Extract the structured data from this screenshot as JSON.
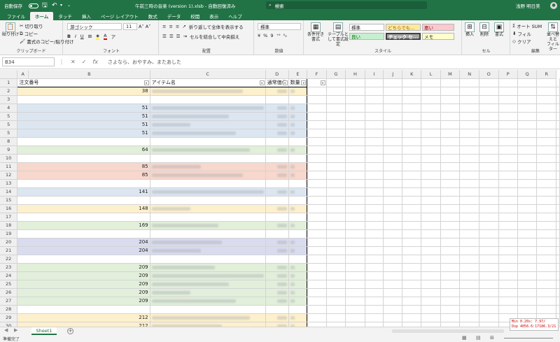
{
  "titlebar": {
    "autosave": "自動保存",
    "title": "午前三時の音楽 (version 1).xlsb - 自動回復済み",
    "search_placeholder": "検索",
    "user": "浅野 明日美"
  },
  "tabs": [
    "ファイル",
    "ホーム",
    "タッチ",
    "挿入",
    "ページ レイアウト",
    "数式",
    "データ",
    "校閲",
    "表示",
    "ヘルプ"
  ],
  "ribbon": {
    "clipboard": {
      "paste": "貼り付け",
      "cut": "切り取り",
      "copy": "コピー",
      "format_painter": "書式のコピー/貼り付け",
      "label": "クリップボード"
    },
    "font": {
      "name": "游ゴシック",
      "size": "11",
      "label": "フォント"
    },
    "alignment": {
      "wrap": "折り返して全体を表示する",
      "merge": "セルを結合して中央揃え",
      "label": "配置"
    },
    "number": {
      "format": "標準",
      "label": "数値"
    },
    "styles": {
      "cond_format": "条件付き書式",
      "table_format": "テーブルとして書式設定",
      "standard": "標準",
      "neutral": "どちらでも...",
      "bad": "悪い",
      "good": "良い",
      "check": "チェック セ...",
      "memo": "メモ",
      "label": "スタイル"
    },
    "cells": {
      "insert": "挿入",
      "delete": "削除",
      "format": "書式",
      "label": "セル"
    },
    "editing": {
      "autosum": "オート SUM",
      "fill": "フィル",
      "clear": "クリア",
      "sort": "並べ替えと",
      "filter": "フィルター",
      "label": "編集"
    }
  },
  "formula": {
    "namebox": "B34",
    "content": "さよなら、おやすみ、またあした"
  },
  "columns": [
    "A",
    "B",
    "C",
    "D",
    "E",
    "F",
    "G",
    "H",
    "I",
    "J",
    "K",
    "L",
    "M",
    "N",
    "O",
    "P",
    "Q",
    "R"
  ],
  "headers": {
    "a": "注文番号",
    "b": "アイテム名",
    "c": "通常価格",
    "d": "数量"
  },
  "rows": [
    {
      "n": "1",
      "a": "",
      "c": "#fff"
    },
    {
      "n": "2",
      "a": "38",
      "c": "#fdf0cc"
    },
    {
      "n": "3",
      "a": "",
      "c": "#fff"
    },
    {
      "n": "4",
      "a": "51",
      "c": "#dce6f1"
    },
    {
      "n": "5",
      "a": "51",
      "c": "#dce6f1"
    },
    {
      "n": "5",
      "a": "51",
      "c": "#dce6f1"
    },
    {
      "n": "5",
      "a": "51",
      "c": "#dce6f1"
    },
    {
      "n": "8",
      "a": "",
      "c": "#fff"
    },
    {
      "n": "9",
      "a": "64",
      "c": "#e2efda"
    },
    {
      "n": "10",
      "a": "",
      "c": "#fff"
    },
    {
      "n": "11",
      "a": "85",
      "c": "#f8d7cc"
    },
    {
      "n": "12",
      "a": "85",
      "c": "#f8d7cc"
    },
    {
      "n": "13",
      "a": "",
      "c": "#fff"
    },
    {
      "n": "14",
      "a": "141",
      "c": "#dce6f1"
    },
    {
      "n": "15",
      "a": "",
      "c": "#fff"
    },
    {
      "n": "16",
      "a": "148",
      "c": "#fdf0cc"
    },
    {
      "n": "17",
      "a": "",
      "c": "#fff"
    },
    {
      "n": "18",
      "a": "169",
      "c": "#e2efda"
    },
    {
      "n": "19",
      "a": "",
      "c": "#fff"
    },
    {
      "n": "20",
      "a": "204",
      "c": "#d9dcef"
    },
    {
      "n": "21",
      "a": "204",
      "c": "#d9dcef"
    },
    {
      "n": "22",
      "a": "",
      "c": "#fff"
    },
    {
      "n": "23",
      "a": "209",
      "c": "#e2efda"
    },
    {
      "n": "24",
      "a": "209",
      "c": "#e2efda"
    },
    {
      "n": "25",
      "a": "209",
      "c": "#e2efda"
    },
    {
      "n": "26",
      "a": "209",
      "c": "#e2efda"
    },
    {
      "n": "27",
      "a": "209",
      "c": "#e2efda"
    },
    {
      "n": "28",
      "a": "",
      "c": "#fff"
    },
    {
      "n": "29",
      "a": "212",
      "c": "#fdf0cc"
    },
    {
      "n": "30",
      "a": "212",
      "c": "#fdf0cc"
    }
  ],
  "sheet_tab": "Sheet1",
  "overlay": {
    "line1": "Min  0.20s:   7.97/",
    "line2": "Dsp 4056.6:17186.3/21"
  },
  "status": "準備完了"
}
